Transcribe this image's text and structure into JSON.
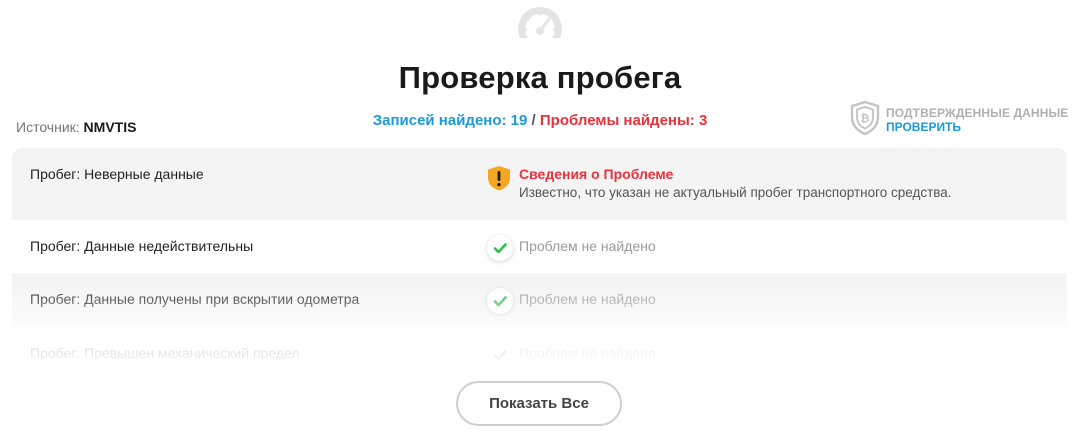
{
  "header": {
    "icon": "speedometer-icon",
    "title": "Проверка пробега"
  },
  "source": {
    "label": "Источник:",
    "value": "NMVTIS"
  },
  "summary": {
    "found_text": "Записей найдено: 19",
    "separator": "/",
    "problems_text": "Проблемы найдены: 3",
    "colors": {
      "found": "#1a9bd7",
      "problems": "#e8323c"
    }
  },
  "verified": {
    "icon": "shield-icon",
    "label": "ПОДТВЕРЖДЕННЫЕ ДАННЫЕ",
    "link": "ПРОВЕРИТЬ"
  },
  "checks": [
    {
      "label": "Пробег: Неверные данные",
      "status": "problem",
      "icon": "warning-shield-icon",
      "problem_title": "Сведения о Проблеме",
      "problem_description": "Известно, что указан не актуальный пробег транспортного средства."
    },
    {
      "label": "Пробег: Данные недействительны",
      "status": "ok",
      "icon": "checkmark-icon",
      "status_text": "Проблем не найдено"
    },
    {
      "label": "Пробег: Данные получены при вскрытии одометра",
      "status": "ok",
      "icon": "checkmark-icon",
      "status_text": "Проблем не найдено"
    },
    {
      "label": "Пробег: Превышен механический предел",
      "status": "ok",
      "icon": "checkmark-icon",
      "status_text": "Проблем не найдено"
    }
  ],
  "show_all_button": "Показать Все"
}
